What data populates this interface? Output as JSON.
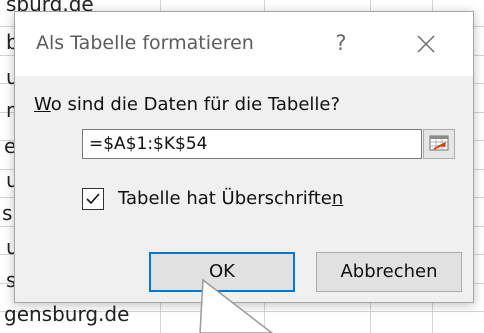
{
  "spreadsheet": {
    "fragments": [
      "spurg.de",
      "b",
      "u",
      "n",
      "er",
      "u",
      "sb",
      "u",
      "s",
      "gensburg.de"
    ]
  },
  "dialog": {
    "title": "Als Tabelle formatieren",
    "help_label": "?",
    "prompt_prefix": "W",
    "prompt_rest": "o sind die Daten für die Tabelle?",
    "range_value": "=$A$1:$K$54",
    "checkbox": {
      "checked": true,
      "label_main": "Tabelle hat Überschrifte",
      "label_accel": "n"
    },
    "ok_label": "OK",
    "cancel_label": "Abbrechen"
  },
  "colors": {
    "accent": "#0078d7",
    "dialog_bg": "#f0f0f0",
    "gridline": "#d4d4d4"
  },
  "icons": [
    "close-icon",
    "collapse-dialog-icon",
    "checkmark-icon",
    "mouse-pointer-icon"
  ]
}
